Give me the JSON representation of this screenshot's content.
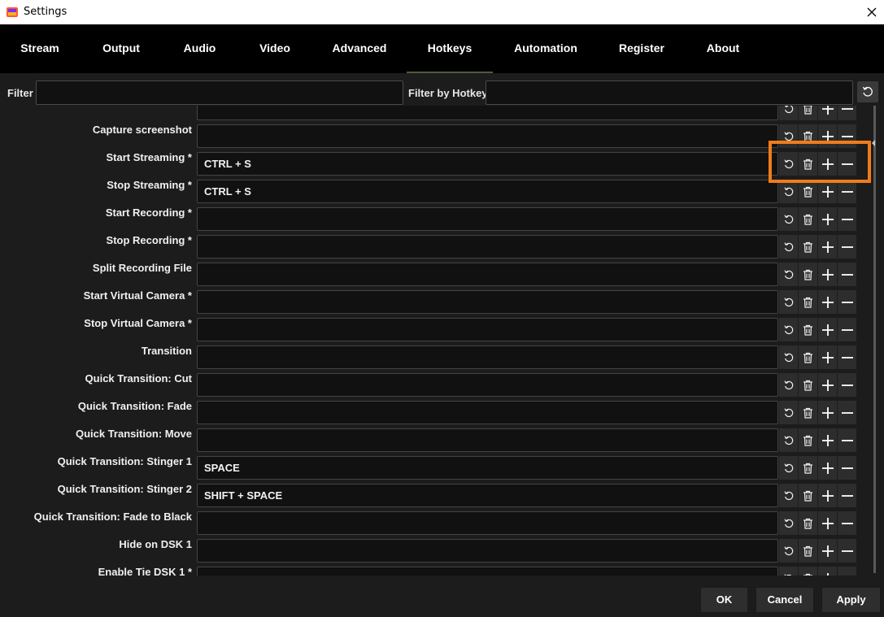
{
  "window": {
    "title": "Settings",
    "app_icon": "app-logo-icon",
    "close_icon": "close-icon"
  },
  "tabs": [
    {
      "label": "Stream"
    },
    {
      "label": "Output"
    },
    {
      "label": "Audio"
    },
    {
      "label": "Video"
    },
    {
      "label": "Advanced"
    },
    {
      "label": "Hotkeys",
      "active": true
    },
    {
      "label": "Automation"
    },
    {
      "label": "Register"
    },
    {
      "label": "About"
    }
  ],
  "filter": {
    "label": "Filter",
    "value": "",
    "hotkey_label": "Filter by Hotkey",
    "hotkey_value": "",
    "reset_icon": "reset-icon"
  },
  "hotkeys": [
    {
      "label": "",
      "value": ""
    },
    {
      "label": "Capture screenshot",
      "value": ""
    },
    {
      "label": "Start Streaming *",
      "value": "CTRL + S"
    },
    {
      "label": "Stop Streaming *",
      "value": "CTRL + S"
    },
    {
      "label": "Start Recording *",
      "value": ""
    },
    {
      "label": "Stop Recording *",
      "value": ""
    },
    {
      "label": "Split Recording File",
      "value": ""
    },
    {
      "label": "Start Virtual Camera *",
      "value": ""
    },
    {
      "label": "Stop Virtual Camera *",
      "value": ""
    },
    {
      "label": "Transition",
      "value": ""
    },
    {
      "label": "Quick Transition: Cut",
      "value": ""
    },
    {
      "label": "Quick Transition: Fade",
      "value": ""
    },
    {
      "label": "Quick Transition: Move",
      "value": ""
    },
    {
      "label": "Quick Transition: Stinger 1",
      "value": "SPACE"
    },
    {
      "label": "Quick Transition: Stinger 2",
      "value": "SHIFT + SPACE"
    },
    {
      "label": "Quick Transition: Fade to Black",
      "value": ""
    },
    {
      "label": "Hide on DSK 1",
      "value": ""
    },
    {
      "label": "Enable Tie DSK 1 *",
      "value": ""
    }
  ],
  "row_icons": [
    "revert-icon",
    "trash-icon",
    "plus-icon",
    "minus-icon"
  ],
  "highlight_color": "#f07c1a",
  "footer": {
    "ok": "OK",
    "cancel": "Cancel",
    "apply": "Apply"
  }
}
